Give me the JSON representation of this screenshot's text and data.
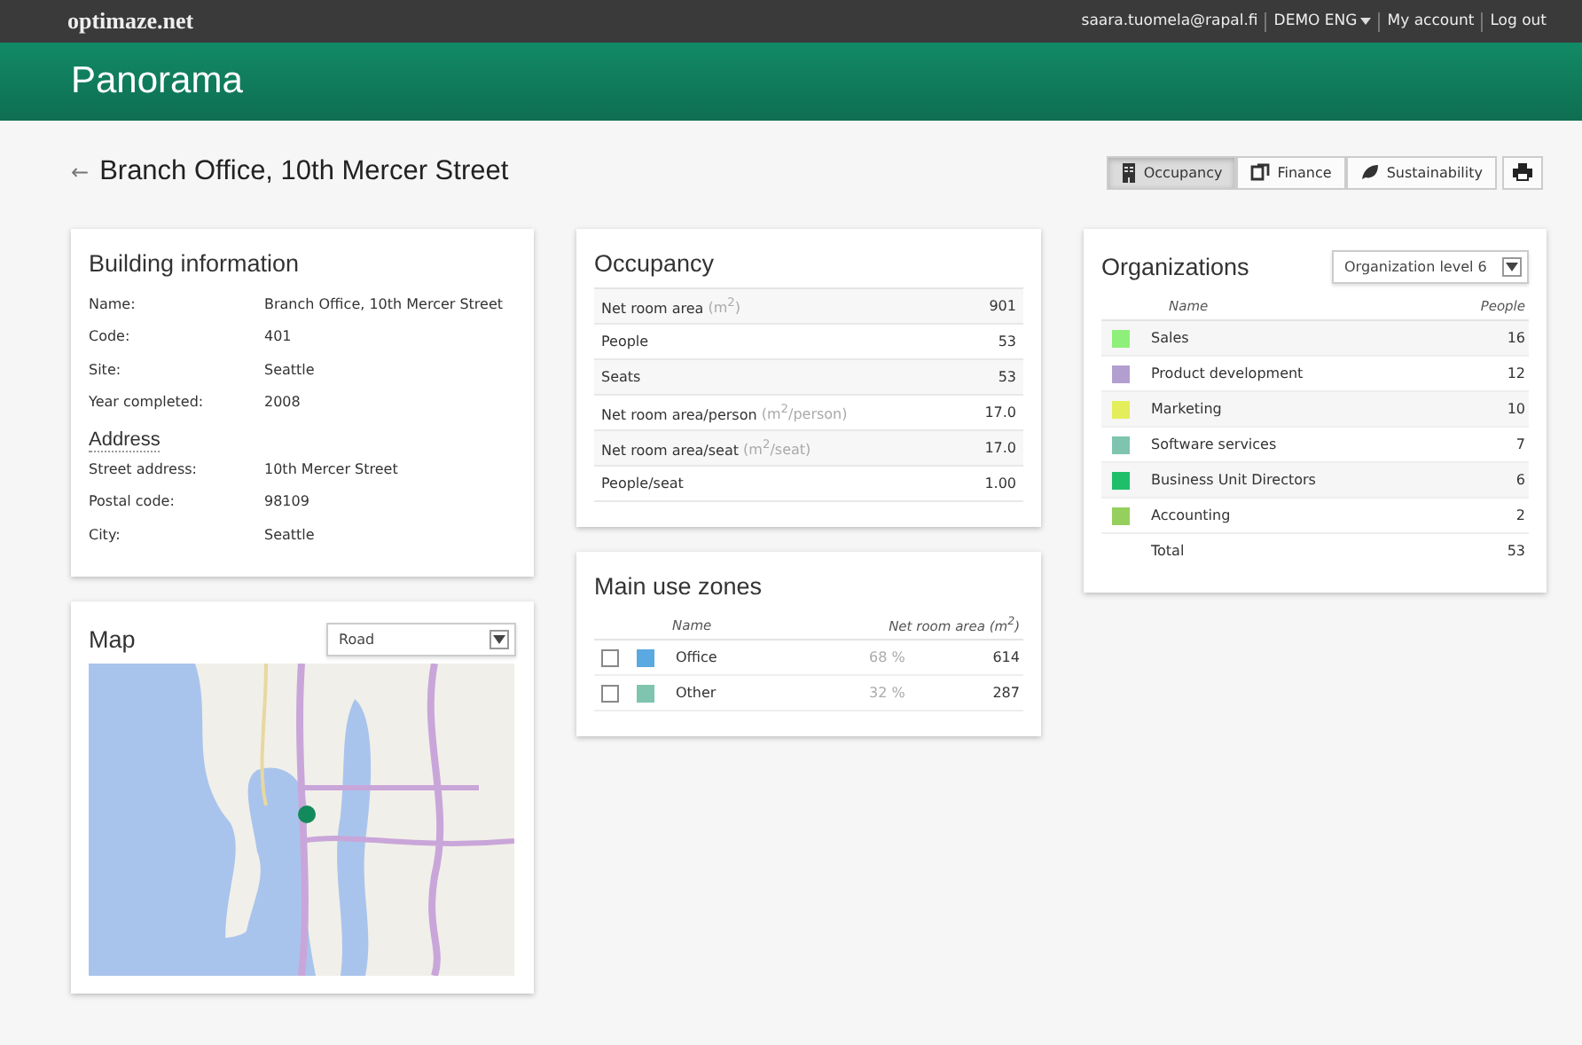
{
  "topbar": {
    "logo": "optimaze.net",
    "links": [
      {
        "label": "saara.tuomela@rapal.fi",
        "caret": false
      },
      {
        "label": "DEMO ENG",
        "caret": true
      },
      {
        "label": "My account",
        "caret": false
      },
      {
        "label": "Log out",
        "caret": false
      }
    ]
  },
  "app_title": "Panorama",
  "page": {
    "back": "←",
    "title": "Branch Office, 10th Mercer Street"
  },
  "tabs": [
    {
      "label": "Occupancy",
      "selected": true
    },
    {
      "label": "Finance",
      "selected": false
    },
    {
      "label": "Sustainability",
      "selected": false
    }
  ],
  "building": {
    "title": "Building information",
    "fields": [
      {
        "label": "Name:",
        "value": "Branch Office, 10th Mercer Street"
      },
      {
        "label": "Code:",
        "value": "401"
      },
      {
        "label": "Site:",
        "value": "Seattle"
      },
      {
        "label": "Year completed:",
        "value": "2008"
      }
    ],
    "address_title": "Address",
    "address": [
      {
        "label": "Street address:",
        "value": "10th Mercer Street"
      },
      {
        "label": "Postal code:",
        "value": "98109"
      },
      {
        "label": "City:",
        "value": "Seattle"
      }
    ]
  },
  "map": {
    "title": "Map",
    "select": "Road"
  },
  "occupancy": {
    "title": "Occupancy",
    "rows": [
      {
        "label": "Net room area",
        "unit": "(m$^{2}$)",
        "value": "901"
      },
      {
        "label": "People",
        "value": "53"
      },
      {
        "label": "Seats",
        "value": "53"
      },
      {
        "label": "Net room area/person",
        "unit": "(m$^{2}$/person)",
        "value": "17.0"
      },
      {
        "label": "Net room area/seat",
        "unit": "(m$^{2}$/seat)",
        "value": "17.0"
      },
      {
        "label": "People/seat",
        "value": "1.00"
      }
    ]
  },
  "zones": {
    "title": "Main use zones",
    "columns": [
      "Name",
      "Net room area (m$^{2}$)"
    ],
    "rows": [
      {
        "checked": false,
        "color": "#5aa9e0",
        "name": "Office",
        "share": "68 %",
        "value": "614"
      },
      {
        "checked": false,
        "color": "#7ec4ae",
        "name": "Other",
        "share": "32 %",
        "value": "287"
      }
    ]
  },
  "organizations": {
    "title": "Organizations",
    "select": "Organization level 6",
    "columns": [
      "Name",
      "People"
    ],
    "rows": [
      {
        "color": "#8ef07a",
        "name": "Sales",
        "people": "16"
      },
      {
        "color": "#b39fcf",
        "name": "Product development",
        "people": "12"
      },
      {
        "color": "#e3ee5a",
        "name": "Marketing",
        "people": "10"
      },
      {
        "color": "#7ec4ae",
        "name": "Software services",
        "people": "7"
      },
      {
        "color": "#1fbf6a",
        "name": "Business Unit Directors",
        "people": "6"
      },
      {
        "color": "#95cf5e",
        "name": "Accounting",
        "people": "2"
      }
    ],
    "total": {
      "label": "Total",
      "people": "53"
    }
  }
}
